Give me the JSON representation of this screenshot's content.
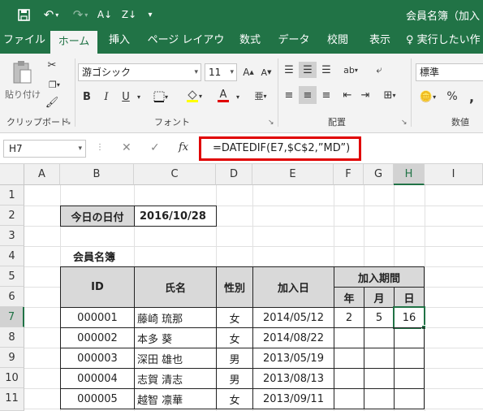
{
  "title_bar": {
    "title": "会員名簿（加入"
  },
  "ribbon_tabs": [
    {
      "label": "ファイル"
    },
    {
      "label": "ホーム"
    },
    {
      "label": "挿入"
    },
    {
      "label": "ページ レイアウト"
    },
    {
      "label": "数式"
    },
    {
      "label": "データ"
    },
    {
      "label": "校閲"
    },
    {
      "label": "表示"
    },
    {
      "label": "♀ 実行したい作"
    }
  ],
  "ribbon": {
    "paste_label": "貼り付け",
    "clipboard_label": "クリップボード",
    "font_name": "游ゴシック",
    "font_size": "11",
    "font_label": "フォント",
    "bold": "B",
    "italic": "I",
    "underline": "U",
    "align_label": "配置",
    "number_format": "標準",
    "number_label": "数値",
    "percent": "%",
    "comma": ","
  },
  "formula_bar": {
    "name_box": "H7",
    "fx": "fx",
    "formula": "=DATEDIF(E7,$C$2,”MD”)"
  },
  "columns": [
    "A",
    "B",
    "C",
    "D",
    "E",
    "F",
    "G",
    "H",
    "I"
  ],
  "rows": [
    "1",
    "2",
    "3",
    "4",
    "5",
    "6",
    "7",
    "8",
    "9",
    "10",
    "11"
  ],
  "sheet": {
    "today_label": "今日の日付",
    "today_value": "2016/10/28",
    "table_title": "会員名簿",
    "hdr_id": "ID",
    "hdr_name": "氏名",
    "hdr_gender": "性別",
    "hdr_join": "加入日",
    "hdr_period": "加入期間",
    "hdr_year": "年",
    "hdr_month": "月",
    "hdr_day": "日",
    "members": [
      {
        "id": "000001",
        "name": "藤崎 琉那",
        "gender": "女",
        "date": "2014/05/12",
        "y": "2",
        "m": "5",
        "d": "16"
      },
      {
        "id": "000002",
        "name": "本多 葵",
        "gender": "女",
        "date": "2014/08/22",
        "y": "",
        "m": "",
        "d": ""
      },
      {
        "id": "000003",
        "name": "深田 雄也",
        "gender": "男",
        "date": "2013/05/19",
        "y": "",
        "m": "",
        "d": ""
      },
      {
        "id": "000004",
        "name": "志賀 清志",
        "gender": "男",
        "date": "2013/08/13",
        "y": "",
        "m": "",
        "d": ""
      },
      {
        "id": "000005",
        "name": "越智 凛華",
        "gender": "女",
        "date": "2013/09/11",
        "y": "",
        "m": "",
        "d": ""
      }
    ]
  }
}
